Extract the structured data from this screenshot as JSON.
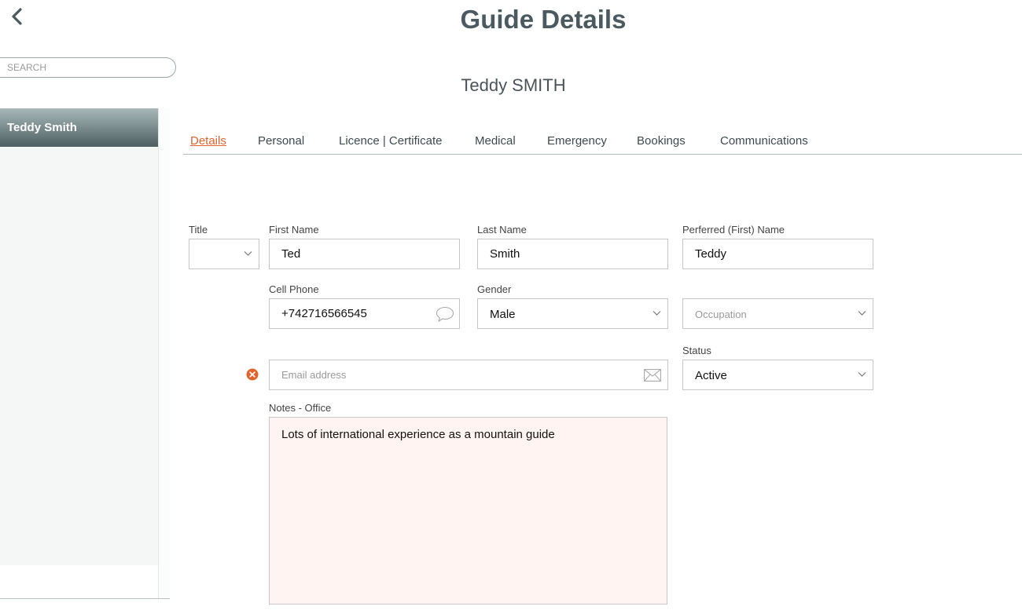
{
  "header": {
    "title": "Guide Details"
  },
  "sidebar": {
    "search_placeholder": "SEARCH",
    "items": [
      {
        "label": "Teddy Smith"
      }
    ]
  },
  "guide": {
    "display_name": "Teddy SMITH"
  },
  "tabs": [
    {
      "label": "Details"
    },
    {
      "label": "Personal"
    },
    {
      "label": "Licence | Certificate"
    },
    {
      "label": "Medical"
    },
    {
      "label": "Emergency"
    },
    {
      "label": "Bookings"
    },
    {
      "label": "Communications"
    }
  ],
  "form": {
    "title": {
      "label": "Title",
      "value": ""
    },
    "first_name": {
      "label": "First Name",
      "value": "Ted"
    },
    "last_name": {
      "label": "Last Name",
      "value": "Smith"
    },
    "preferred_name": {
      "label": "Perferred (First) Name",
      "value": "Teddy"
    },
    "cell_phone": {
      "label": "Cell Phone",
      "value": "+742716566545"
    },
    "gender": {
      "label": "Gender",
      "value": "Male"
    },
    "occupation": {
      "placeholder": "Occupation"
    },
    "email": {
      "placeholder": "Email address"
    },
    "status": {
      "label": "Status",
      "value": "Active"
    },
    "notes": {
      "label": "Notes - Office",
      "value": "Lots of international experience as a mountain guide"
    }
  },
  "colors": {
    "accent": "#e2622b",
    "heading": "#4a5a60",
    "notes_bg": "#fff4f1"
  },
  "icons": {
    "back": "chevron-left-icon",
    "phone_chat": "speech-bubble-icon",
    "email": "envelope-icon",
    "error": "error-circle-icon",
    "dropdown": "chevron-down-icon"
  }
}
